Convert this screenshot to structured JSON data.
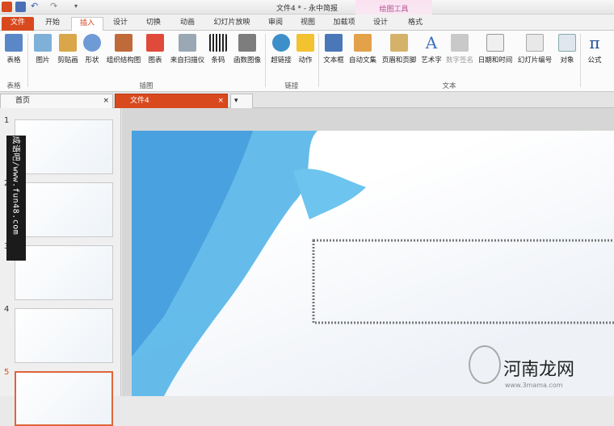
{
  "window": {
    "title": "文件4 * - 永中简报"
  },
  "tabs": [
    "文件",
    "开始",
    "插入",
    "设计",
    "切换",
    "动画",
    "幻灯片放映",
    "审阅",
    "视图",
    "加载项",
    "设计",
    "格式"
  ],
  "contextual_group": "绘图工具",
  "ribbon": {
    "buttons": [
      "表格",
      "图片",
      "剪贴画",
      "形状",
      "组织结构图",
      "图表",
      "来自扫描仪",
      "条码",
      "函数图像",
      "超链接",
      "动作",
      "文本框",
      "自动文集",
      "页眉和页脚",
      "艺术字",
      "数字签名",
      "日期和时间",
      "幻灯片编号",
      "对象",
      "公式"
    ],
    "groups": [
      "表格",
      "插图",
      "链接",
      "文本"
    ]
  },
  "doc_tabs": {
    "home": "首页",
    "doc": "文件4",
    "close": "×"
  },
  "slides": {
    "numbers": [
      "1",
      "2",
      "3",
      "4",
      "5"
    ]
  },
  "watermark": {
    "text": "成语吧/www.fun48.com"
  },
  "logo": {
    "title": "河南龙网",
    "url": "www.3mama.com"
  }
}
